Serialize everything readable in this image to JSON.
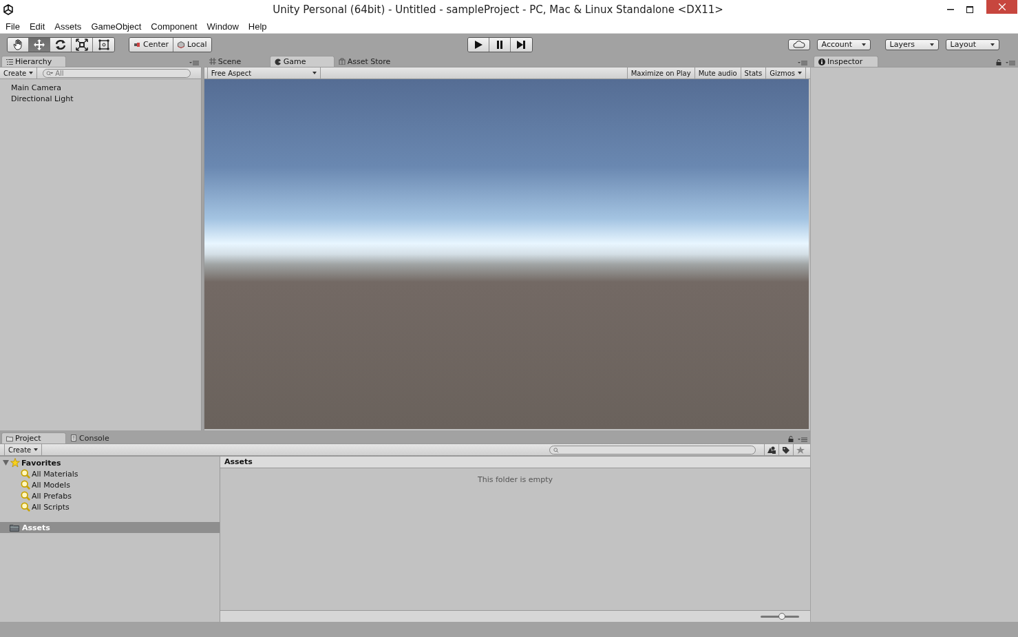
{
  "window": {
    "title": "Unity Personal (64bit) - Untitled - sampleProject - PC, Mac & Linux Standalone <DX11>"
  },
  "menu": [
    "File",
    "Edit",
    "Assets",
    "GameObject",
    "Component",
    "Window",
    "Help"
  ],
  "toolbar": {
    "tools": [
      {
        "kind": "hand",
        "selected": false
      },
      {
        "kind": "move",
        "selected": true
      },
      {
        "kind": "rotate",
        "selected": false
      },
      {
        "kind": "scale",
        "selected": false
      },
      {
        "kind": "rect",
        "selected": false
      }
    ],
    "pivot": [
      "Center",
      "Local"
    ],
    "right": [
      "Account",
      "Layers",
      "Layout"
    ]
  },
  "hierarchy": {
    "tab": "Hierarchy",
    "create": "Create",
    "search": {
      "placeholder": "All"
    },
    "items": [
      "Main Camera",
      "Directional Light"
    ]
  },
  "view_tabs": [
    {
      "kind": "scene",
      "label": "Scene",
      "selected": false
    },
    {
      "kind": "game",
      "label": "Game",
      "selected": true
    },
    {
      "kind": "store",
      "label": "Asset Store",
      "selected": false
    }
  ],
  "game_toolbar": {
    "aspect": "Free Aspect",
    "toggles": [
      "Maximize on Play",
      "Mute audio",
      "Stats"
    ],
    "gizmos": "Gizmos"
  },
  "inspector": {
    "tab": "Inspector"
  },
  "project": {
    "tabs": [
      {
        "kind": "project",
        "label": "Project",
        "selected": true
      },
      {
        "kind": "console",
        "label": "Console",
        "selected": false
      }
    ],
    "create": "Create",
    "favorites": {
      "label": "Favorites",
      "expanded": true,
      "children": [
        "All Materials",
        "All Models",
        "All Prefabs",
        "All Scripts"
      ]
    },
    "root": {
      "label": "Assets",
      "selected": true
    },
    "breadcrumb": "Assets",
    "empty_message": "This folder is empty",
    "zoom_slider": {
      "level": 0.55
    }
  }
}
